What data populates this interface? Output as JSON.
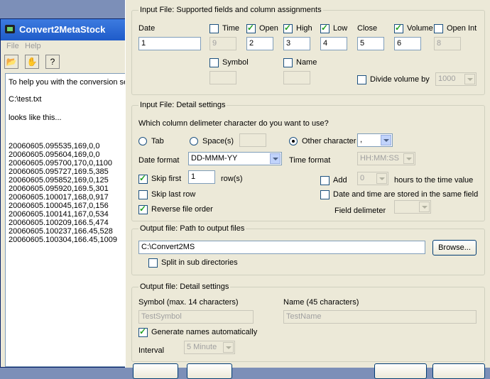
{
  "bg_window": {
    "title": "Convert2MetaStock",
    "menu": [
      "File",
      "Help"
    ],
    "toolbar_icons": [
      "open-folder-icon",
      "wizard-icon",
      "help-icon"
    ],
    "text_lines": [
      "To help you with the conversion se",
      "C:\\test.txt",
      "looks like this...",
      "20060605.095535,169,0,0",
      "20060605.095604,169,0,0",
      "20060605.095700,170,0,1100",
      "20060605.095727,169.5,385",
      "20060605.095852,169,0,125",
      "20060605.095920,169.5,301",
      "20060605.100017,168,0,917",
      "20060605.100045,167,0,156",
      "20060605.100141,167,0,534",
      "20060605.100209,166.5,474",
      "20060605.100237,166.45,528",
      "20060605.100304,166.45,1009"
    ]
  },
  "input_fields": {
    "legend": "Input File: Supported fields and column assignments",
    "date_label": "Date",
    "date_value": "1",
    "time_label": "Time",
    "time_value": "9",
    "open_label": "Open",
    "open_value": "2",
    "high_label": "High",
    "high_value": "3",
    "low_label": "Low",
    "low_value": "4",
    "close_label": "Close",
    "close_value": "5",
    "volume_label": "Volume",
    "volume_value": "6",
    "openint_label": "Open Int",
    "openint_value": "8",
    "symbol_label": "Symbol",
    "name_label": "Name",
    "divide_label": "Divide volume by",
    "divide_value": "1000"
  },
  "detail": {
    "legend": "Input File: Detail settings",
    "delim_question": "Which column delimeter character do you want to use?",
    "tab_label": "Tab",
    "spaces_label": "Space(s)",
    "other_label": "Other character",
    "other_value": ",",
    "date_format_label": "Date format",
    "date_format_value": "DD-MMM-YY",
    "time_format_label": "Time format",
    "time_format_value": "HH:MM:SS",
    "skip_first_label": "Skip first",
    "skip_first_value": "1",
    "rows_label": "row(s)",
    "add_label": "Add",
    "add_value": "0",
    "hours_label": "hours to the time value",
    "skip_last_label": "Skip last row",
    "same_field_label": "Date and time are stored in the same field",
    "reverse_label": "Reverse file order",
    "field_delim_label": "Field delimeter"
  },
  "output_path": {
    "legend": "Output file: Path to output files",
    "path_value": "C:\\Convert2MS",
    "browse_label": "Browse...",
    "split_label": "Split in sub directories"
  },
  "output_detail": {
    "legend": "Output file: Detail settings",
    "symbol_label": "Symbol (max. 14 characters)",
    "symbol_value": "TestSymbol",
    "name_label": "Name (45 characters)",
    "name_value": "TestName",
    "generate_label": "Generate names automatically",
    "interval_label": "Interval",
    "interval_value": "5 Minute"
  }
}
